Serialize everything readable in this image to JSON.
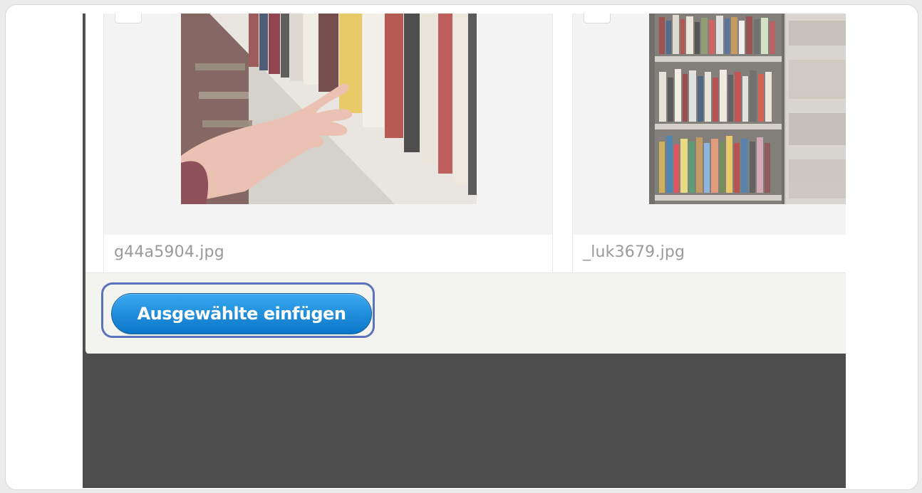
{
  "media_grid": {
    "items": [
      {
        "filename": "g44a5904.jpg",
        "thumbnail_icon": "bookshelf-hand-photo"
      },
      {
        "filename": "_luk3679.jpg",
        "thumbnail_icon": "library-shelves-photo"
      }
    ]
  },
  "button_pane": {
    "insert_selected_label": "Ausgewählte einfügen"
  },
  "colors": {
    "primary_button": "#0a76c8",
    "focus_ring": "#5b73b8",
    "overlay_background": "#4d4d4d",
    "button_pane_background": "#f3f3f0"
  }
}
